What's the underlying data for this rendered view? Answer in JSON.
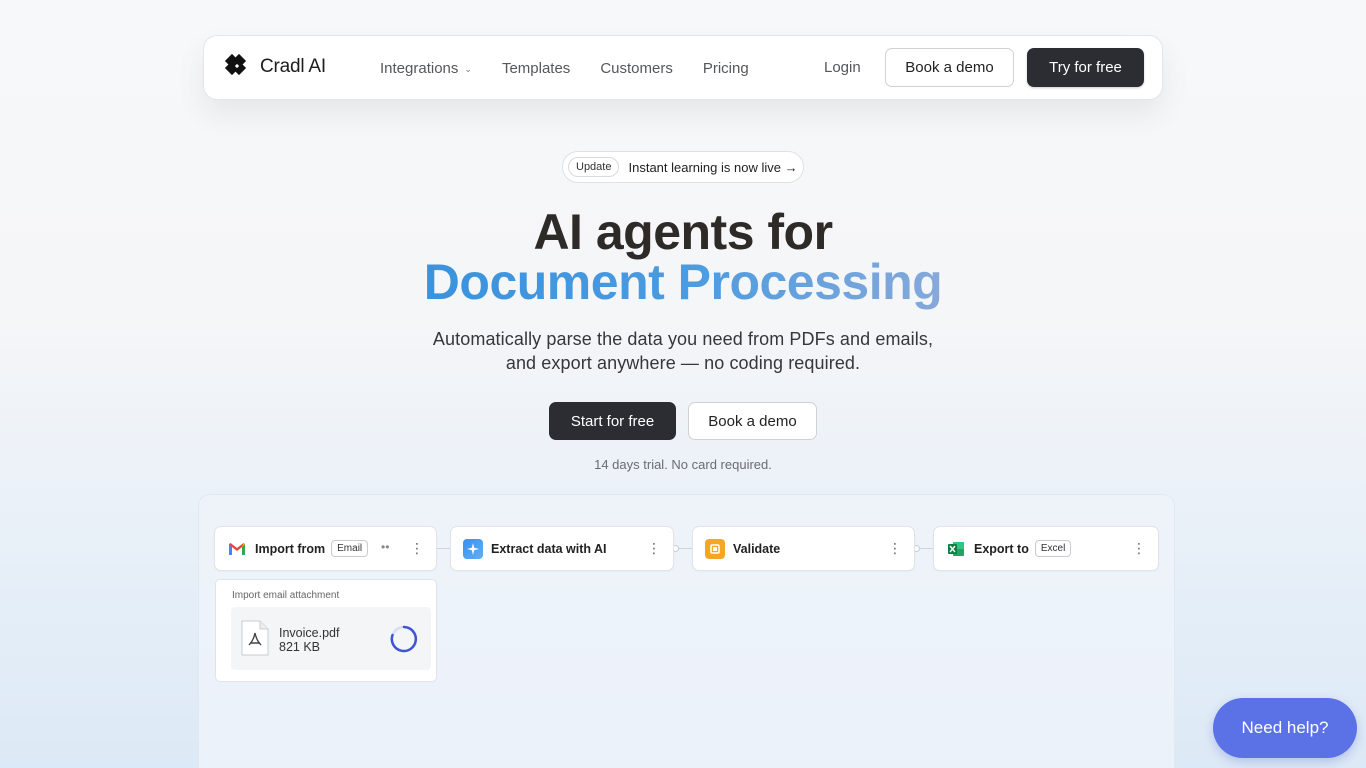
{
  "nav": {
    "brand": "Cradl AI",
    "links": [
      "Integrations",
      "Templates",
      "Customers",
      "Pricing"
    ],
    "login": "Login",
    "book_demo": "Book a demo",
    "try_free": "Try for free"
  },
  "announcement": {
    "badge": "Update",
    "text": "Instant learning is now live →"
  },
  "hero": {
    "title_line1": "AI agents for",
    "title_line2": "Document Processing",
    "subtitle_line1": "Automatically parse the data you need from PDFs and emails,",
    "subtitle_line2": "and export anywhere — no coding required.",
    "cta_primary": "Start for free",
    "cta_secondary": "Book a demo",
    "trial_note": "14 days trial. No card required."
  },
  "workflow": {
    "nodes": [
      {
        "label": "Import from",
        "tag": "Email",
        "icon": "gmail-icon"
      },
      {
        "label": "Extract data with AI",
        "tag": "",
        "icon": "sparkle-icon"
      },
      {
        "label": "Validate",
        "tag": "",
        "icon": "validate-icon"
      },
      {
        "label": "Export to",
        "tag": "Excel",
        "icon": "excel-icon"
      }
    ],
    "attachment": {
      "title": "Import email attachment",
      "file_name": "Invoice.pdf",
      "file_size": "821 KB"
    }
  },
  "help_button": "Need help?",
  "colors": {
    "dark_button": "#2b2d32",
    "accent_blue": "#3a93dd",
    "help_button": "#5b72e6"
  }
}
